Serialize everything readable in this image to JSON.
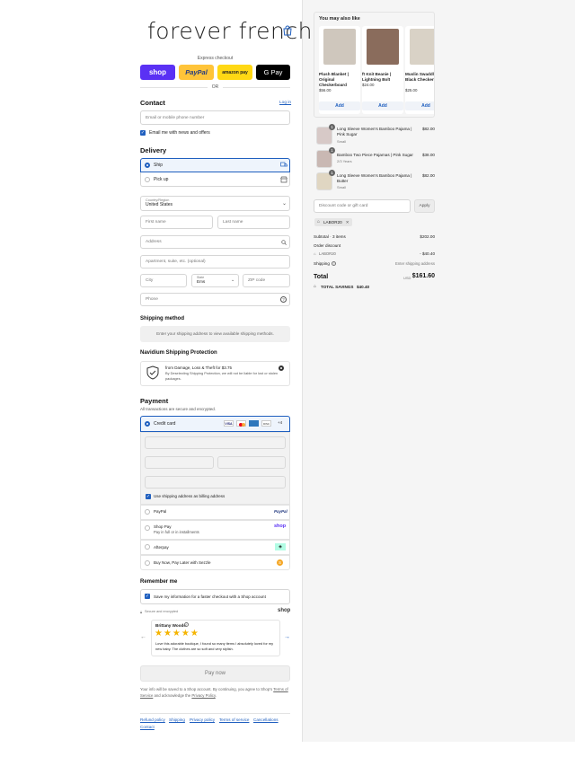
{
  "brand": {
    "logo_text": "forever french"
  },
  "express": {
    "heading": "Express checkout",
    "or_label": "OR",
    "buttons": [
      {
        "label": "shop",
        "color": "#5a31f4"
      },
      {
        "label": "PayPal",
        "color": "#ffc439"
      },
      {
        "label": "amazon pay",
        "color": "#ffd814"
      },
      {
        "label": "G Pay",
        "color": "#000000"
      }
    ]
  },
  "contact": {
    "heading": "Contact",
    "login_link": "Log in",
    "email_placeholder": "Email or mobile phone number",
    "newsletter_label": "Email me with news and offers"
  },
  "delivery": {
    "heading": "Delivery",
    "options": [
      {
        "label": "Ship"
      },
      {
        "label": "Pick up"
      }
    ],
    "country_label": "Country/Region",
    "country_value": "United States",
    "first_name": "First name",
    "last_name": "Last name",
    "address": "Address",
    "apartment": "Apartment, suite, etc. (optional)",
    "city": "City",
    "state_label": "State",
    "state_value": "Ems",
    "zip": "ZIP code",
    "phone": "Phone"
  },
  "shipping_method": {
    "heading": "Shipping method",
    "message": "Enter your shipping address to view available shipping methods."
  },
  "protection": {
    "heading": "Navidium Shipping Protection",
    "line1": "from Damage, Loss & Theft for $3.75",
    "line2": "By Deselecting Shipping Protection, we will not be liable for lost or stolen packages."
  },
  "payment": {
    "heading": "Payment",
    "subtitle": "All transactions are secure and encrypted.",
    "credit_card_label": "Credit card",
    "card_more": "+4",
    "billing_label": "Use shipping address as billing address",
    "methods": [
      {
        "label": "PayPal",
        "sub": "",
        "badge": "PayPal"
      },
      {
        "label": "Shop Pay",
        "sub": "Pay in full or in installments",
        "badge": "shop"
      },
      {
        "label": "Afterpay",
        "sub": "",
        "badge": "◈"
      },
      {
        "label": "Buy Now, Pay Later with Sezzle",
        "sub": "",
        "badge": "S"
      }
    ]
  },
  "remember": {
    "heading": "Remember me",
    "save_label": "Save my information for a faster checkout with a Shop account",
    "secure_label": "Secure and encrypted",
    "shop_label": "shop"
  },
  "review": {
    "author": "Brittany Woods",
    "text": "Love this adorable boutique, I found so many items I absolutely loved for my new baby. The clothes are so soft and very stylish.",
    "rating": 5
  },
  "pay_now": "Pay now",
  "terms": {
    "pre": "Your info will be saved to a Shop account. By continuing, you agree to Shop's",
    "terms_link": "Terms of Service",
    "mid": "and acknowledge the",
    "privacy_link": "Privacy Policy",
    "end": "."
  },
  "footer_links": [
    "Refund policy",
    "Shipping",
    "Privacy policy",
    "Terms of service",
    "Cancellations",
    "Contact"
  ],
  "upsell": {
    "heading": "You may also like",
    "add_label": "Add",
    "items": [
      {
        "name": "Plush Blanket | Original Checkerboard",
        "price": "$56.00",
        "img": "#cfc7bd"
      },
      {
        "name": "ft Knit Beanie | Lightning Bolt",
        "price": "$24.00",
        "img": "#8a6c5c"
      },
      {
        "name": "Muslin Swaddle | Black Checkerboard",
        "price": "$25.00",
        "img": "#d9d2c6"
      }
    ]
  },
  "cart": {
    "items": [
      {
        "name": "Long Sleeve Women's Bamboo Pajama | Pink Sugar",
        "variant": "Small",
        "price": "$82.00",
        "qty": "1",
        "img": "#d7c9c7"
      },
      {
        "name": "Bamboo Two Piece Pajamas | Pink Sugar",
        "variant": "2/3 Years",
        "price": "$38.00",
        "qty": "1",
        "img": "#c9b8b3"
      },
      {
        "name": "Long Sleeve Women's Bamboo Pajama | Butter",
        "variant": "Small",
        "price": "$82.00",
        "qty": "1",
        "img": "#e0d6c2"
      }
    ],
    "discount_placeholder": "Discount code or gift card",
    "apply_label": "Apply",
    "code_tag": "LABOR20",
    "subtotal_label": "Subtotal · 3 items",
    "subtotal_value": "$202.00",
    "order_discount_label": "Order discount",
    "discount_code": "LABOR20",
    "discount_value": "- $40.40",
    "shipping_label": "Shipping",
    "shipping_value": "Enter shipping address",
    "total_label": "Total",
    "currency": "USD",
    "total_value": "$161.60",
    "savings_label": "TOTAL SAVINGS",
    "savings_value": "$40.40"
  }
}
